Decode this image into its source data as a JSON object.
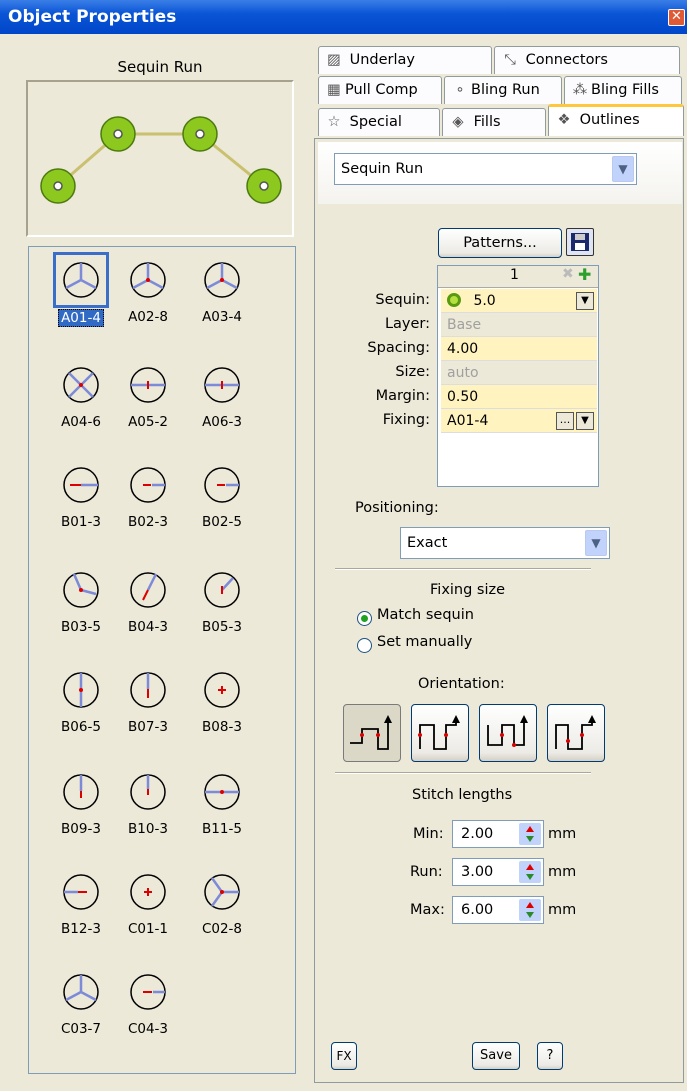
{
  "window": {
    "title": "Object Properties",
    "close": "✕"
  },
  "left": {
    "preview_title": "Sequin Run",
    "patterns": [
      {
        "label": "A01-4"
      },
      {
        "label": "A02-8"
      },
      {
        "label": "A03-4"
      },
      {
        "label": "A04-6"
      },
      {
        "label": "A05-2"
      },
      {
        "label": "A06-3"
      },
      {
        "label": "B01-3"
      },
      {
        "label": "B02-3"
      },
      {
        "label": "B02-5"
      },
      {
        "label": "B03-5"
      },
      {
        "label": "B04-3"
      },
      {
        "label": "B05-3"
      },
      {
        "label": "B06-5"
      },
      {
        "label": "B07-3"
      },
      {
        "label": "B08-3"
      },
      {
        "label": "B09-3"
      },
      {
        "label": "B10-3"
      },
      {
        "label": "B11-5"
      },
      {
        "label": "B12-3"
      },
      {
        "label": "C01-1"
      },
      {
        "label": "C02-8"
      },
      {
        "label": "C03-7"
      },
      {
        "label": "C04-3"
      }
    ],
    "selected": "A01-4"
  },
  "tabs": {
    "underlay": "Underlay",
    "connectors": "Connectors",
    "pull_comp": "Pull Comp",
    "bling_run": "Bling Run",
    "bling_fills": "Bling Fills",
    "special": "Special",
    "fills": "Fills",
    "outlines": "Outlines",
    "active": "Outlines"
  },
  "outlines": {
    "type_value": "Sequin Run",
    "patterns_button": "Patterns...",
    "grid_header": "1",
    "rows": {
      "sequin_label": "Sequin:",
      "sequin_value": "5.0",
      "layer_label": "Layer:",
      "layer_value": "Base",
      "spacing_label": "Spacing:",
      "spacing_value": "4.00",
      "size_label": "Size:",
      "size_value": "auto",
      "margin_label": "Margin:",
      "margin_value": "0.50",
      "fixing_label": "Fixing:",
      "fixing_value": "A01-4"
    },
    "positioning_label": "Positioning:",
    "positioning_value": "Exact",
    "fixing_size_label": "Fixing size",
    "match_sequin": "Match sequin",
    "set_manually": "Set manually",
    "fixing_size_selected": "Match sequin",
    "orientation_label": "Orientation:",
    "orientation_selected": 1,
    "stitch_lengths_label": "Stitch lengths",
    "min_label": "Min:",
    "min_value": "2.00",
    "run_label": "Run:",
    "run_value": "3.00",
    "max_label": "Max:",
    "max_value": "6.00",
    "unit": "mm"
  },
  "footer": {
    "fx": "FX",
    "save": "Save",
    "help": "?"
  },
  "colors": {
    "title_bar": "#0a55d6",
    "accent_tab": "#ffc83c",
    "sequin_green": "#8cc81e",
    "selection": "#316ac5",
    "input_yellow": "#fff4c0"
  }
}
